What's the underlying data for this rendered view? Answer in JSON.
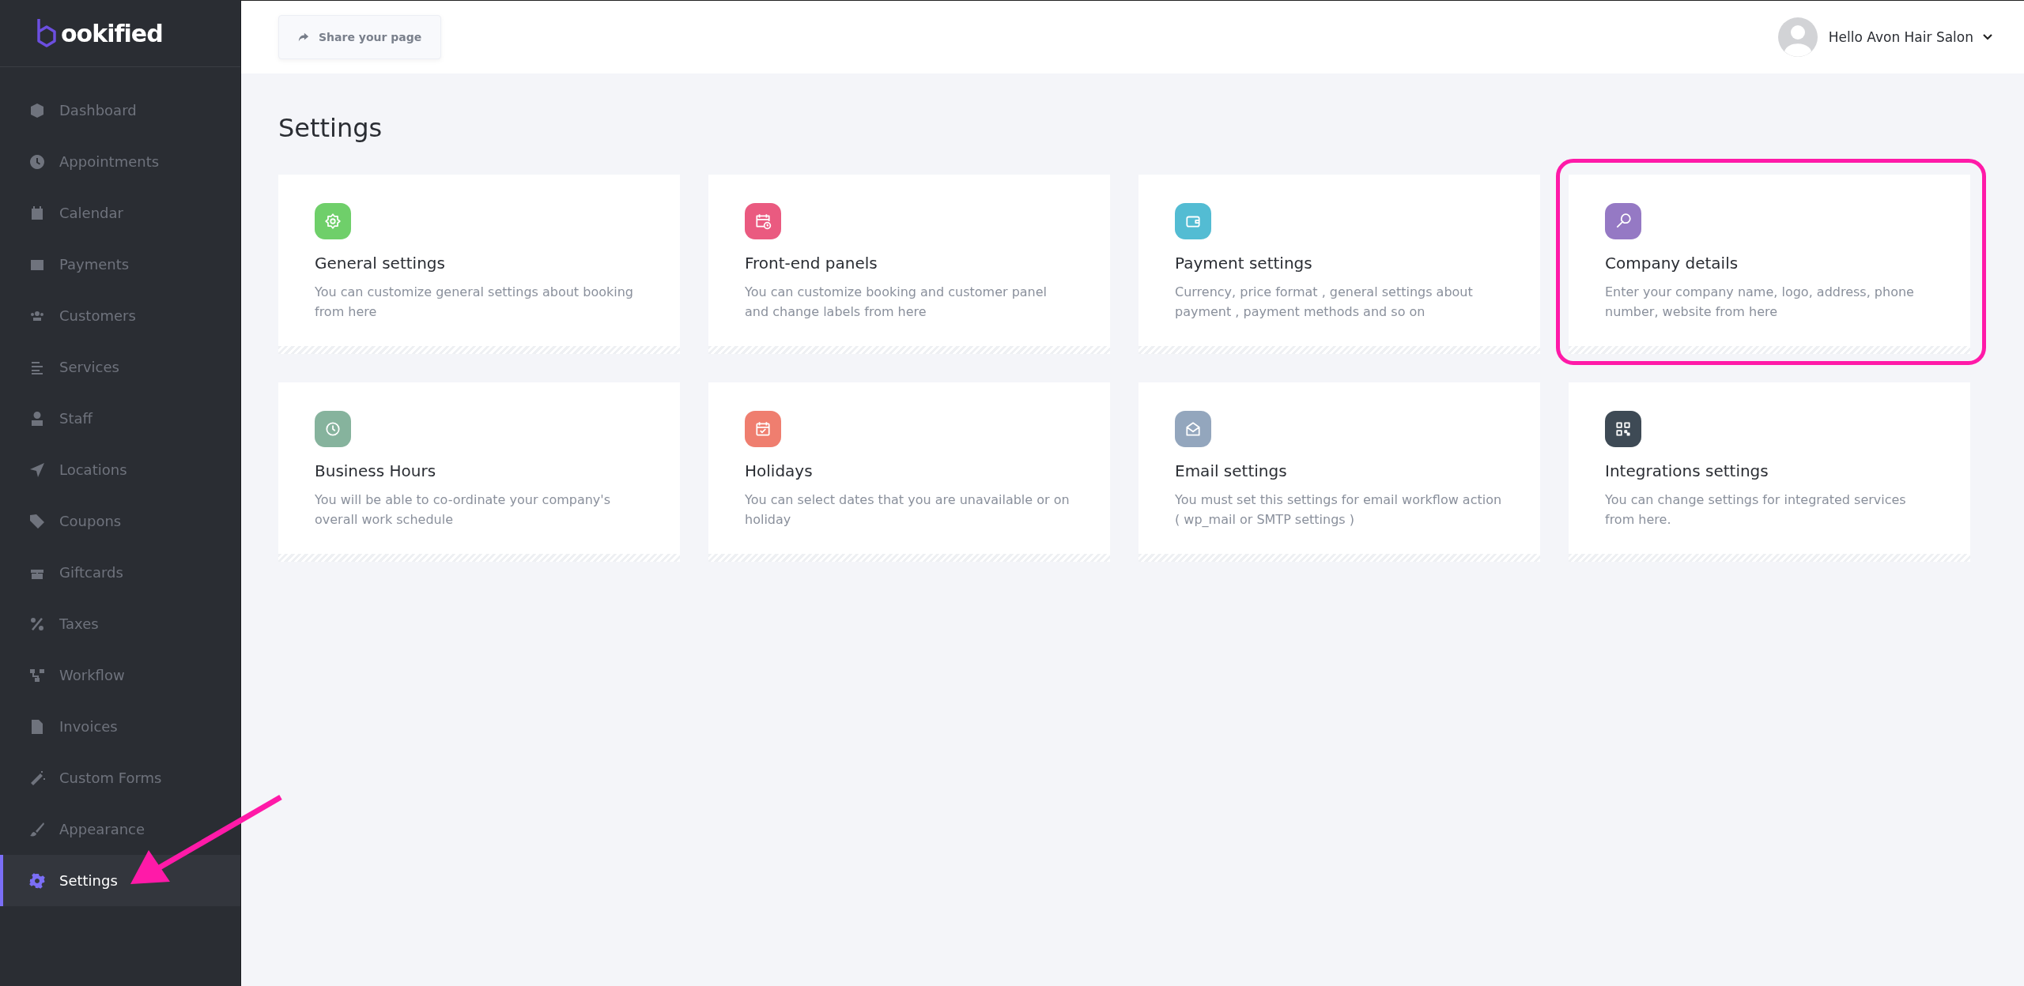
{
  "logo": {
    "text": "ookified"
  },
  "sidebar": {
    "items": [
      {
        "label": "Dashboard",
        "selected": false,
        "pointed_at": false
      },
      {
        "label": "Appointments",
        "selected": false,
        "pointed_at": false
      },
      {
        "label": "Calendar",
        "selected": false,
        "pointed_at": false
      },
      {
        "label": "Payments",
        "selected": false,
        "pointed_at": false
      },
      {
        "label": "Customers",
        "selected": false,
        "pointed_at": false
      },
      {
        "label": "Services",
        "selected": false,
        "pointed_at": false
      },
      {
        "label": "Staff",
        "selected": false,
        "pointed_at": false
      },
      {
        "label": "Locations",
        "selected": false,
        "pointed_at": false
      },
      {
        "label": "Coupons",
        "selected": false,
        "pointed_at": false
      },
      {
        "label": "Giftcards",
        "selected": false,
        "pointed_at": false
      },
      {
        "label": "Taxes",
        "selected": false,
        "pointed_at": false
      },
      {
        "label": "Workflow",
        "selected": false,
        "pointed_at": false
      },
      {
        "label": "Invoices",
        "selected": false,
        "pointed_at": false
      },
      {
        "label": "Custom Forms",
        "selected": false,
        "pointed_at": false
      },
      {
        "label": "Appearance",
        "selected": false,
        "pointed_at": false
      },
      {
        "label": "Settings",
        "selected": true,
        "pointed_at": true
      }
    ]
  },
  "header": {
    "share_button": "Share your page",
    "user": "Hello Avon Hair Salon"
  },
  "page_title": "Settings",
  "cards": [
    {
      "title": "General settings",
      "description": "You can customize general settings about booking from here",
      "color": "#6fcf6a",
      "highlighted": false
    },
    {
      "title": "Front-end panels",
      "description": "You can customize booking and customer panel and change labels from here",
      "color": "#ea5a80",
      "highlighted": false
    },
    {
      "title": "Payment settings",
      "description": "Currency, price format , general settings about payment , payment methods and so on",
      "color": "#53bcd3",
      "highlighted": false
    },
    {
      "title": "Company details",
      "description": "Enter your company name, logo, address, phone number, website from here",
      "color": "#9579c4",
      "highlighted": true
    },
    {
      "title": "Business Hours",
      "description": "You will be able to co-ordinate your company's overall work schedule",
      "color": "#86b39d",
      "highlighted": false
    },
    {
      "title": "Holidays",
      "description": "You can select dates that you are unavailable or on holiday",
      "color": "#ef7e6f",
      "highlighted": false
    },
    {
      "title": "Email settings",
      "description": "You must set this settings for email workflow action ( wp_mail or SMTP settings )",
      "color": "#93a6bd",
      "highlighted": false
    },
    {
      "title": "Integrations settings",
      "description": "You can change settings for integrated services from here.",
      "color": "#3e4a55",
      "highlighted": false
    }
  ]
}
